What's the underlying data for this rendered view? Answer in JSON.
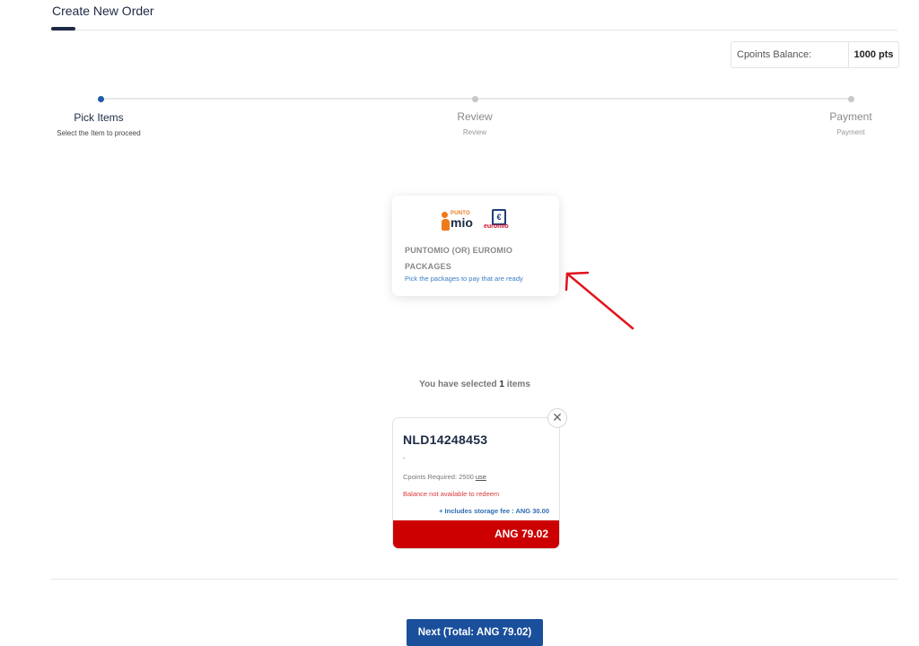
{
  "header": {
    "title": "Create New Order"
  },
  "balance": {
    "label": "Cpoints Balance:",
    "value": "1000 pts"
  },
  "steps": [
    {
      "label": "Pick Items",
      "sub": "Select the Item to proceed",
      "state": "active"
    },
    {
      "label": "Review",
      "sub": "Review",
      "state": "inactive"
    },
    {
      "label": "Payment",
      "sub": "Payment",
      "state": "inactive"
    }
  ],
  "package_card": {
    "logo1_top": "PUNTO",
    "logo1_bottom": "mio",
    "logo2_symbol": "€",
    "logo2_text": "euromio",
    "title": "PUNTOMIO (OR) EUROMIO PACKAGES",
    "subtitle": "Pick the packages to pay that are ready"
  },
  "selection": {
    "prefix": "You have selected",
    "count": "1",
    "suffix": "items"
  },
  "item": {
    "code": "NLD14248453",
    "dash": "-",
    "cpoints_text": "Cpoints Required: 2500",
    "use_link": "use",
    "warning": "Balance not available to redeem",
    "storage_fee": "+ Includes storage fee : ANG 30.00",
    "price": "ANG 79.02",
    "remove_symbol": "✕"
  },
  "footer": {
    "next_label": "Next (Total: ANG 79.02)"
  },
  "colors": {
    "primary": "#1a4f9c",
    "accent_red": "#cc0000",
    "active_dot": "#1f5da8",
    "puntomio_orange": "#ee7a1a"
  }
}
